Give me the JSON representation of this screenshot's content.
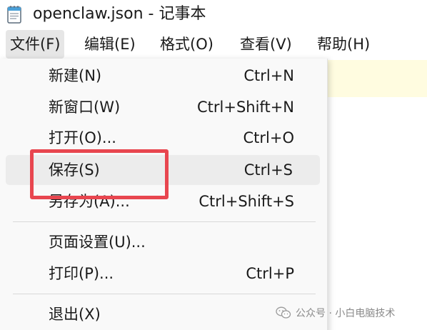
{
  "window": {
    "title": "openclaw.json - 记事本"
  },
  "menubar": {
    "items": [
      {
        "label": "文件(F)",
        "active": true
      },
      {
        "label": "编辑(E)"
      },
      {
        "label": "格式(O)"
      },
      {
        "label": "查看(V)"
      },
      {
        "label": "帮助(H)"
      }
    ]
  },
  "file_menu": {
    "items": [
      {
        "label": "新建(N)",
        "shortcut": "Ctrl+N"
      },
      {
        "label": "新窗口(W)",
        "shortcut": "Ctrl+Shift+N"
      },
      {
        "label": "打开(O)...",
        "shortcut": "Ctrl+O"
      },
      {
        "label": "保存(S)",
        "shortcut": "Ctrl+S",
        "highlighted": true
      },
      {
        "label": "另存为(A)...",
        "shortcut": "Ctrl+Shift+S"
      },
      {
        "label": "页面设置(U)...",
        "shortcut": ""
      },
      {
        "label": "打印(P)...",
        "shortcut": "Ctrl+P"
      },
      {
        "label": "退出(X)",
        "shortcut": ""
      }
    ]
  },
  "annotation": {
    "color": "#e8464f",
    "target": "保存(S)"
  },
  "watermark": {
    "text": "公众号 · 小白电脑技术",
    "icon": "wechat-icon"
  },
  "colors": {
    "menu_background": "#f9f9f9",
    "hover_background": "#ececec",
    "editor_line_highlight": "#fffce0"
  }
}
